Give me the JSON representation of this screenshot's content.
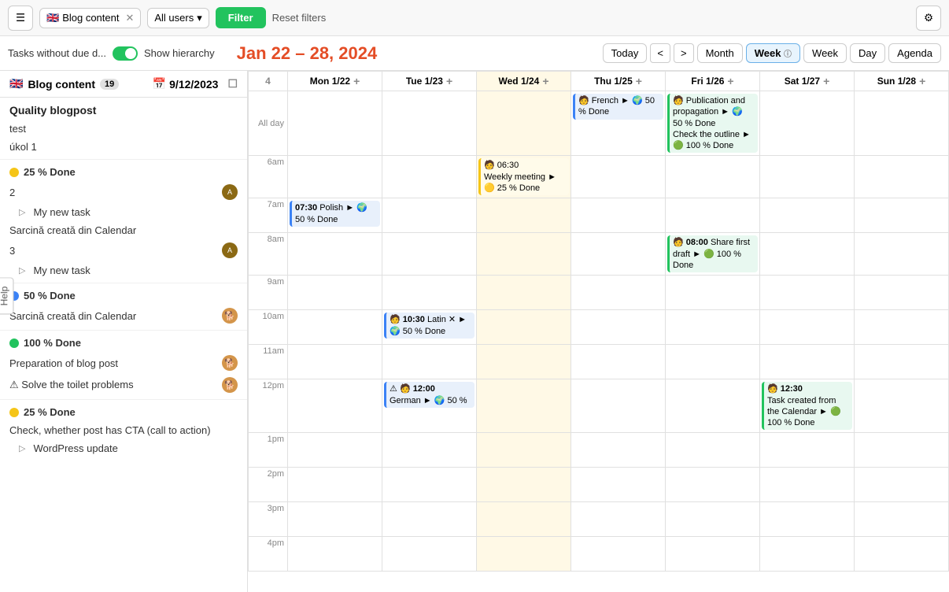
{
  "toolbar": {
    "hamburger_label": "☰",
    "filter_tag_emoji": "🇬🇧",
    "filter_tag_label": "Blog content",
    "filter_tag_close": "✕",
    "filter_dropdown_label": "All users",
    "filter_btn_label": "Filter",
    "reset_label": "Reset filters",
    "settings_icon": "⚙"
  },
  "subnav": {
    "tasks_label": "Tasks without due d...",
    "show_hierarchy": "Show hierarchy",
    "date_range": "Jan 22 – 28, 2024",
    "today": "Today",
    "prev": "<",
    "next": ">",
    "views": [
      "Month",
      "Week",
      "Week",
      "Day",
      "Agenda"
    ],
    "active_view": "Week"
  },
  "sidebar": {
    "header_emoji": "🇬🇧",
    "header_title": "Blog content",
    "badge": "19",
    "date_label": "9/12/2023",
    "sections": [
      {
        "title": "Quality blogpost",
        "items": [
          {
            "label": "test",
            "avatar": null,
            "dog": false
          },
          {
            "label": "úkol 1",
            "avatar": null,
            "dog": false
          }
        ]
      }
    ],
    "status_sections": [
      {
        "status_color": "yellow",
        "status_label": "25 % Done",
        "items": [
          {
            "label": "2",
            "avatar": true,
            "dog": false
          },
          {
            "label": "My new task",
            "sub": true,
            "expand": true,
            "avatar": false,
            "dog": false
          },
          {
            "label": "Sarcină creată din Calendar",
            "avatar": false,
            "dog": false
          },
          {
            "label": "3",
            "avatar": true,
            "dog": false
          },
          {
            "label": "My new task",
            "sub": true,
            "expand": true,
            "avatar": false,
            "dog": false
          }
        ]
      },
      {
        "status_color": "blue",
        "status_label": "50 % Done",
        "items": [
          {
            "label": "Sarcină creată din Calendar",
            "avatar": false,
            "dog": true
          }
        ]
      },
      {
        "status_color": "green",
        "status_label": "100 % Done",
        "items": [
          {
            "label": "Preparation of blog post",
            "avatar": false,
            "dog": true
          },
          {
            "label": "⚠ Solve the toilet problems",
            "avatar": false,
            "dog": true
          }
        ]
      },
      {
        "status_color": "yellow",
        "status_label": "25 % Done",
        "items": [
          {
            "label": "Check, whether post has CTA (call to action)",
            "avatar": false,
            "dog": false
          },
          {
            "label": "WordPress update",
            "sub": true,
            "expand": true,
            "avatar": false,
            "dog": false
          }
        ]
      }
    ]
  },
  "calendar": {
    "col_week": {
      "num": "4",
      "label": ""
    },
    "columns": [
      {
        "day": "Mon 1/22",
        "today": false
      },
      {
        "day": "Tue 1/23",
        "today": false
      },
      {
        "day": "Wed 1/24",
        "today": true
      },
      {
        "day": "Thu 1/25",
        "today": false
      },
      {
        "day": "Fri 1/26",
        "today": false
      },
      {
        "day": "Sat 1/27",
        "today": false
      },
      {
        "day": "Sun 1/28",
        "today": false
      }
    ],
    "time_slots": [
      "6am",
      "7am",
      "8am",
      "9am",
      "10am",
      "11am",
      "12pm",
      "1pm",
      "2pm",
      "3pm",
      "4pm"
    ],
    "all_day_events": [
      {
        "col": 3,
        "text": "French ► 🌍 50 % Done",
        "color": "blue"
      },
      {
        "col": 4,
        "text": "Publication and propagation ► 🌍 50 % Done\nCheck the outline ► 🟢 100 % Done",
        "color": "green"
      }
    ],
    "time_events": [
      {
        "col": 0,
        "time": "07:30",
        "text": "Polish ► 🌍 50 % Done",
        "color": "blue"
      },
      {
        "col": 1,
        "time": "10:30",
        "text": "Latin ✕ ► 🌍 50 % Done",
        "color": "blue"
      },
      {
        "col": 1,
        "time": "12:00",
        "text": "⚠ German ► 🌍 50 %",
        "color": "blue"
      },
      {
        "col": 2,
        "time": "06:30",
        "text": "Weekly meeting ► 🟡 25 % Done",
        "color": "yellow"
      },
      {
        "col": 5,
        "time": "08:00",
        "text": "Share first draft ► 🟢 100 % Done",
        "color": "green"
      },
      {
        "col": 5,
        "time": "12:30",
        "text": "Task created from the Calendar ► 🟢 100 % Done",
        "color": "green"
      }
    ]
  },
  "help_tab": "Help"
}
